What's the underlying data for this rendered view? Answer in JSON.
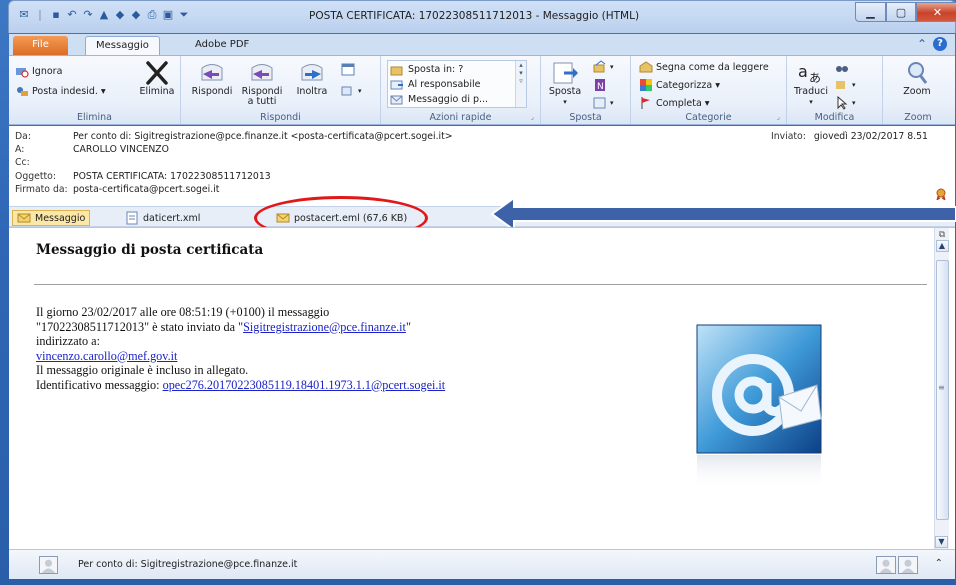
{
  "window": {
    "title": "POSTA CERTIFICATA: 17022308511712013  -  Messaggio (HTML)"
  },
  "ribbon_tabs": {
    "file": "File",
    "message": "Messaggio",
    "adobe": "Adobe PDF"
  },
  "ribbon": {
    "elimina": {
      "ignora": "Ignora",
      "posta_indesid": "Posta indesid. ▾",
      "elimina": "Elimina",
      "label": "Elimina"
    },
    "rispondi": {
      "rispondi": "Rispondi",
      "rispondi_tutti_1": "Rispondi",
      "rispondi_tutti_2": "a tutti",
      "inoltra": "Inoltra",
      "label": "Rispondi"
    },
    "azioni_rapide": {
      "items": [
        "Sposta in: ?",
        "Al responsabile",
        "Messaggio di p..."
      ],
      "label": "Azioni rapide"
    },
    "sposta": {
      "sposta": "Sposta",
      "label": "Sposta"
    },
    "categorie": {
      "segna": "Segna come da leggere",
      "categorizza": "Categorizza ▾",
      "completa": "Completa ▾",
      "label": "Categorie"
    },
    "modifica": {
      "traduci": "Traduci",
      "label": "Modifica"
    },
    "zoom": {
      "zoom": "Zoom",
      "label": "Zoom"
    }
  },
  "header": {
    "da_label": "Da:",
    "da_value": "Per conto di: Sigitregistrazione@pce.finanze.it <posta-certificata@pcert.sogei.it>",
    "a_label": "A:",
    "a_value": "CAROLLO VINCENZO",
    "cc_label": "Cc:",
    "cc_value": "",
    "oggetto_label": "Oggetto:",
    "oggetto_value": "POSTA CERTIFICATA: 17022308511712013",
    "firmato_label": "Firmato da:",
    "firmato_value": "posta-certificata@pcert.sogei.it",
    "inviato_label": "Inviato:",
    "inviato_value": "giovedì 23/02/2017 8.51"
  },
  "attachments": [
    {
      "name": "Messaggio"
    },
    {
      "name": "daticert.xml"
    },
    {
      "name": "postacert.eml (67,6 KB)"
    }
  ],
  "body": {
    "title": "Messaggio di posta certificata",
    "line1": "Il giorno 23/02/2017 alle ore 08:51:19 (+0100) il messaggio",
    "line2a": "\"17022308511712013\" è stato inviato da \"",
    "line2_link": "Sigitregistrazione@pce.finanze.it",
    "line2b": "\"",
    "line3": "indirizzato a:",
    "line4_link": "vincenzo.carollo@mef.gov.it",
    "line5": "Il messaggio originale è incluso in allegato.",
    "line6a": "Identificativo messaggio: ",
    "line6_link": "opec276.20170223085119.18401.1973.1.1@pcert.sogei.it"
  },
  "people_pane": {
    "text": "Per conto di: Sigitregistrazione@pce.finanze.it"
  },
  "colors": {
    "accent": "#2b5b9c",
    "highlight": "#e01818",
    "file_tab": "#d86b24",
    "link": "#1a22c8"
  }
}
